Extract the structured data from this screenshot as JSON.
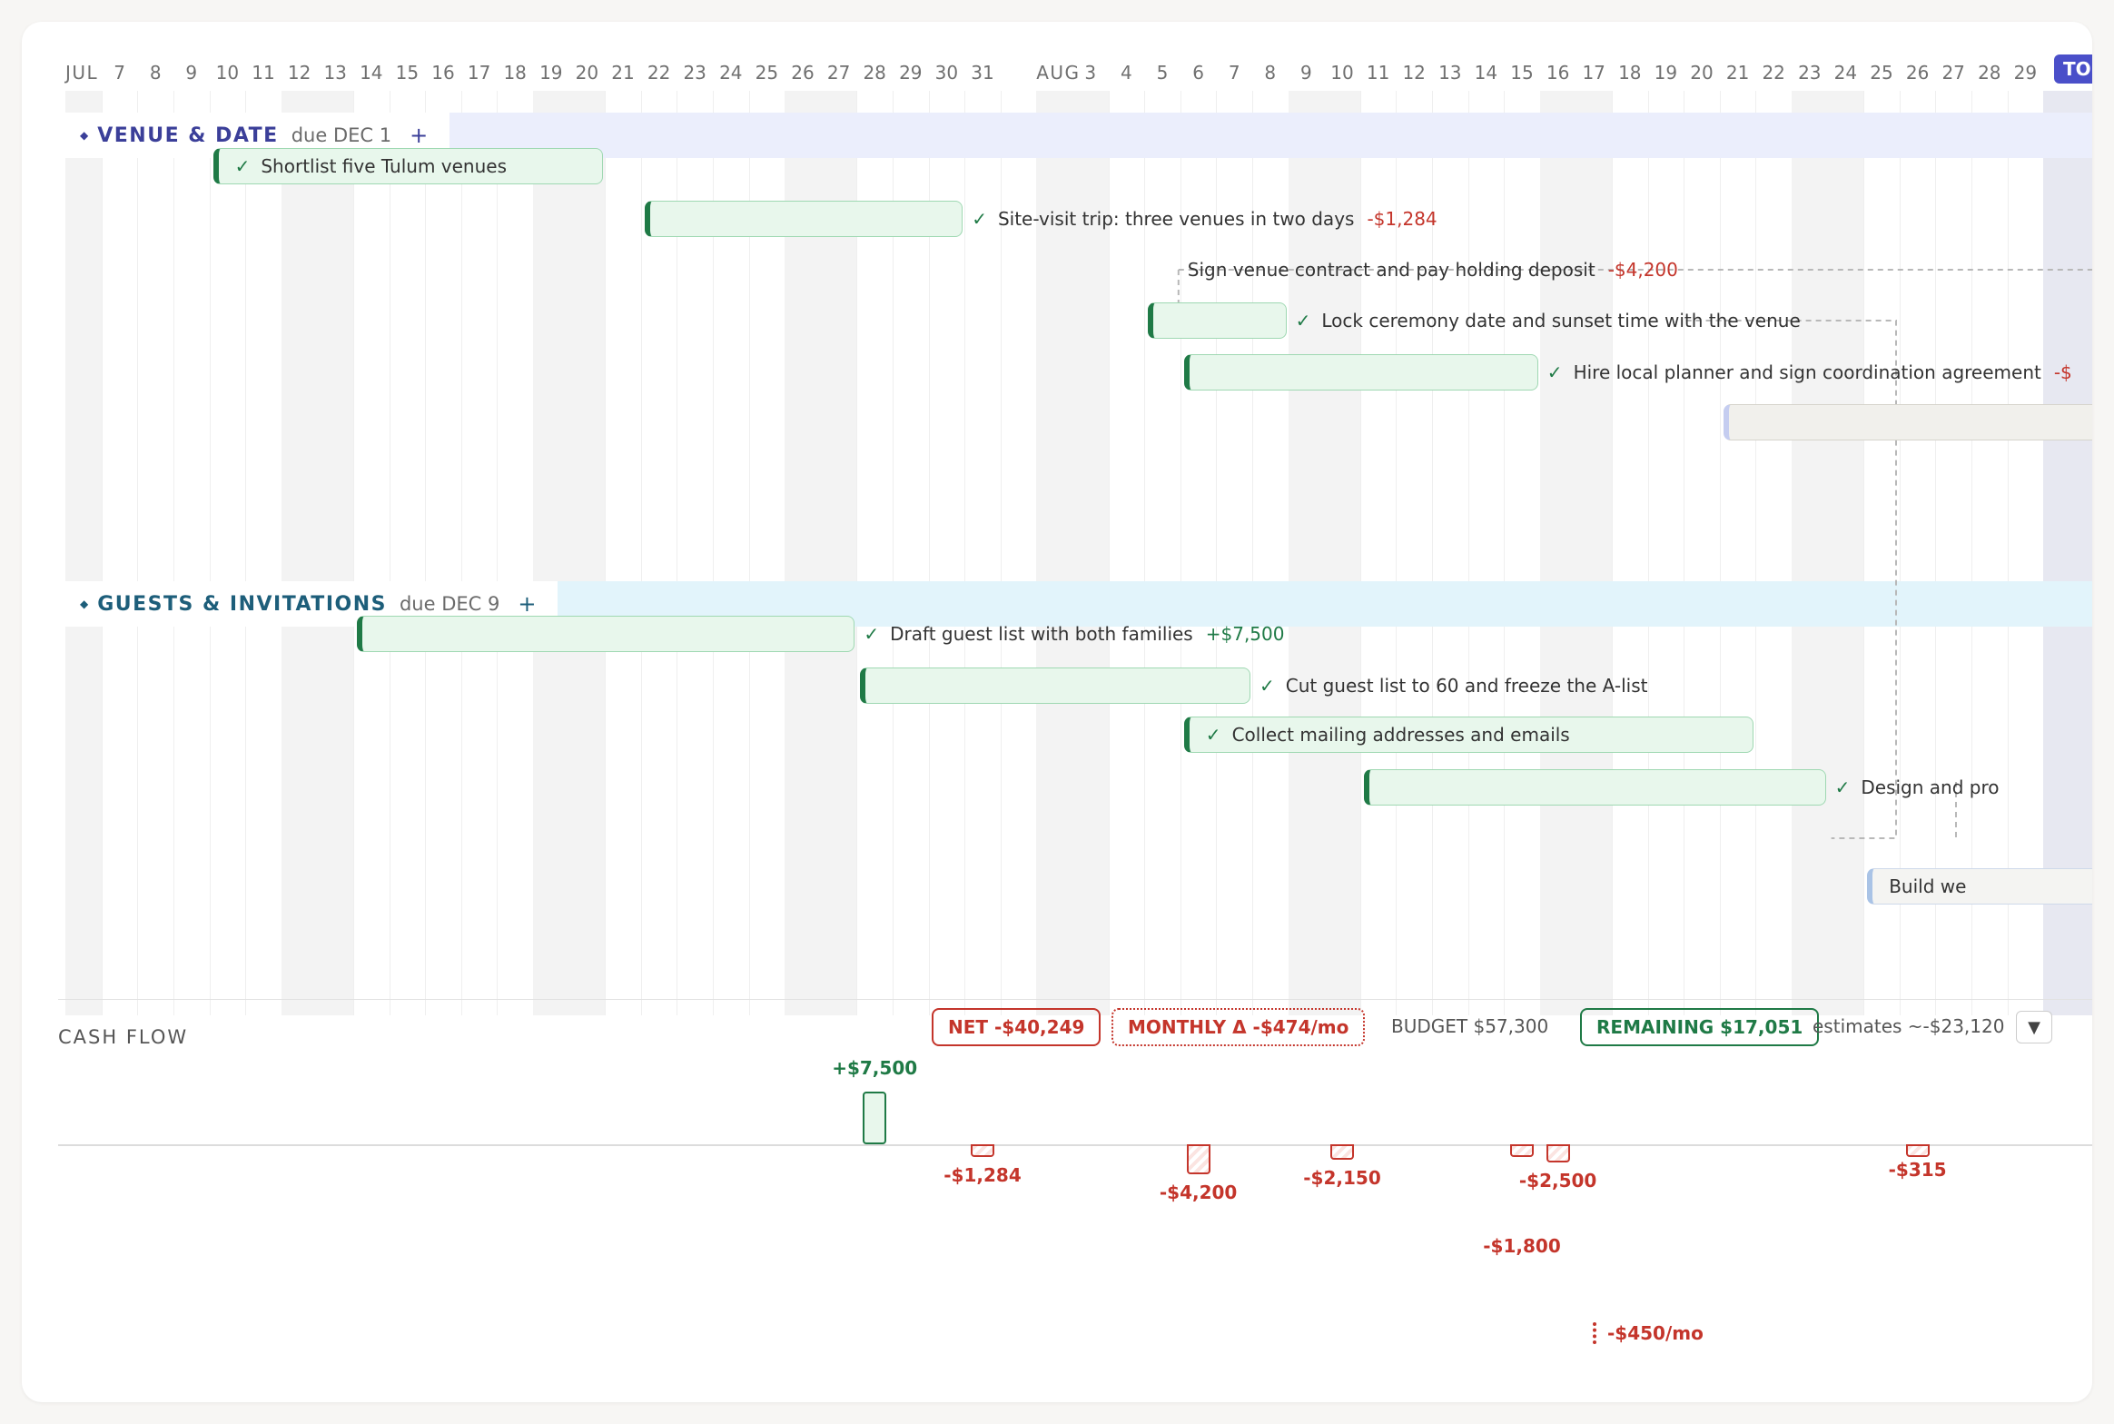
{
  "timeline": {
    "months": [
      {
        "label": "JUL",
        "day": 6
      },
      {
        "label": "AUG",
        "day": 2
      }
    ],
    "start": "2025-07-06",
    "day_ticks_jul": [
      7,
      8,
      9,
      10,
      11,
      12,
      13,
      14,
      15,
      16,
      17,
      18,
      19,
      20,
      21,
      22,
      23,
      24,
      25,
      26,
      27,
      28,
      29,
      30,
      31
    ],
    "day_ticks_aug": [
      3,
      4,
      5,
      6,
      7,
      8,
      9,
      10,
      11,
      12,
      13,
      14,
      15,
      16,
      17,
      18,
      19,
      20,
      21,
      22,
      23,
      24,
      25,
      26,
      27,
      28,
      29
    ],
    "today_badge": "TODAY"
  },
  "groups": [
    {
      "title": "VENUE & DATE",
      "due": "due DEC 1",
      "add_icon": "+",
      "color": "#3b3f99",
      "band": "#ebeefc",
      "tasks": [
        {
          "label": "Shortlist five Tulum venues",
          "start": "2025-07-10",
          "end": "2025-07-20",
          "status": "done",
          "label_inside": true
        },
        {
          "label": "Site-visit trip: three venues in two days",
          "amount": "-$1,284",
          "start": "2025-07-22",
          "end": "2025-07-30",
          "status": "done"
        },
        {
          "label": "Sign venue contract and pay holding deposit",
          "amount": "-$4,200",
          "start": "2025-07-31",
          "end": "2025-08-05",
          "status": "selected",
          "link": true
        },
        {
          "label": "Lock ceremony date and sunset time with the venue",
          "start": "2025-08-05",
          "end": "2025-08-08",
          "status": "done",
          "link": true
        },
        {
          "label": "Hire local planner and sign coordination agreement",
          "amount": "-$",
          "start": "2025-08-06",
          "end": "2025-08-15",
          "status": "done"
        },
        {
          "label": "",
          "start": "2025-08-21",
          "end": "2025-08-31",
          "status": "pending"
        }
      ]
    },
    {
      "title": "GUESTS & INVITATIONS",
      "due": "due DEC 9",
      "add_icon": "+",
      "color": "#1d5e7a",
      "band": "#e2f4fb",
      "tasks": [
        {
          "label": "Draft guest list with both families",
          "amount": "+$7,500",
          "start": "2025-07-14",
          "end": "2025-07-27",
          "status": "done"
        },
        {
          "label": "Cut guest list to 60 and freeze the A-list",
          "start": "2025-07-28",
          "end": "2025-08-07",
          "status": "done"
        },
        {
          "label": "Collect mailing addresses and emails",
          "start": "2025-08-06",
          "end": "2025-08-21",
          "status": "done",
          "label_inside": true
        },
        {
          "label": "Design and pro",
          "start": "2025-08-11",
          "end": "2025-08-23",
          "status": "done"
        },
        {
          "label": "",
          "start": "2025-08-24",
          "end": "2025-08-31",
          "status": "selected"
        },
        {
          "label": "Build we",
          "start": "2025-08-25",
          "end": "2025-08-31",
          "status": "draft",
          "label_inside": true
        }
      ]
    }
  ],
  "cashflow": {
    "title": "CASH FLOW",
    "net": "NET -$40,249",
    "monthly": "MONTHLY Δ -$474/mo",
    "budget": "BUDGET $57,300",
    "remaining": "REMAINING $17,051",
    "estimates": "estimates ~-$23,120",
    "dropdown_icon": "▼",
    "entries": [
      {
        "date": "2025-07-28",
        "amount": 7500,
        "label": "+$7,500"
      },
      {
        "date": "2025-07-31",
        "amount": -1284,
        "label": "-$1,284"
      },
      {
        "date": "2025-08-06",
        "amount": -4200,
        "label": "-$4,200"
      },
      {
        "date": "2025-08-10",
        "amount": -2150,
        "label": "-$2,150"
      },
      {
        "date": "2025-08-15",
        "amount": -1800,
        "label": "-$1,800"
      },
      {
        "date": "2025-08-16",
        "amount": -2500,
        "label": "-$2,500"
      },
      {
        "date": "2025-08-26",
        "amount": -315,
        "label": "-$315"
      }
    ],
    "recurring": "-$450/mo"
  },
  "colors": {
    "done_accent": "#1f7a46",
    "negative": "#c4352b",
    "today": "#4a4fc9"
  }
}
